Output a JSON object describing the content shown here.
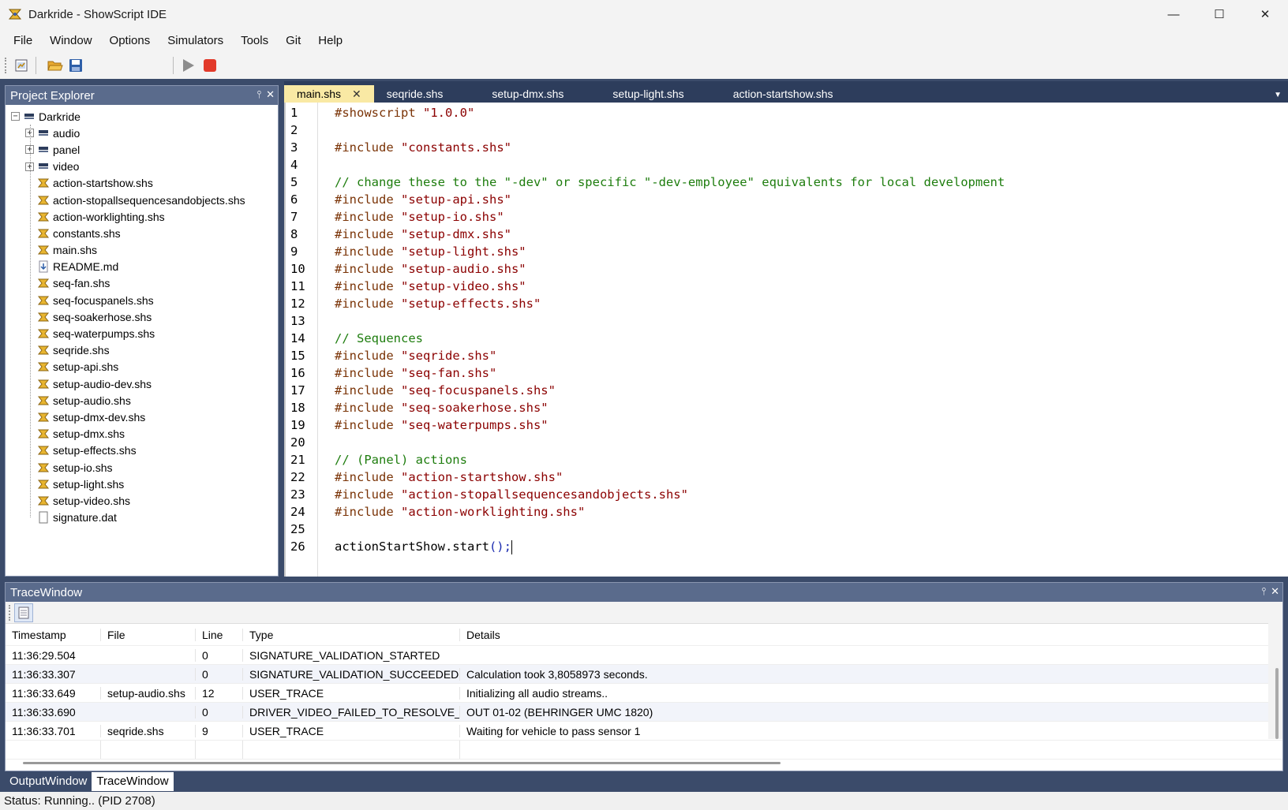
{
  "window": {
    "title": "Darkride - ShowScript IDE",
    "controls": [
      "minimize",
      "maximize",
      "close"
    ]
  },
  "menu": [
    "File",
    "Window",
    "Options",
    "Simulators",
    "Tools",
    "Git",
    "Help"
  ],
  "toolbar": {
    "icons": [
      "new-project-icon",
      "open-folder-icon",
      "save-icon",
      "run-icon",
      "stop-icon"
    ],
    "colors": {
      "run": "#8c8c8c",
      "stop": "#e23a2a",
      "folder": "#e8a930",
      "save": "#2e5fa8"
    }
  },
  "explorer": {
    "title": "Project Explorer",
    "root": "Darkride",
    "folders": [
      "audio",
      "panel",
      "video"
    ],
    "files": [
      "action-startshow.shs",
      "action-stopallsequencesandobjects.shs",
      "action-worklighting.shs",
      "constants.shs",
      "main.shs",
      "README.md",
      "seq-fan.shs",
      "seq-focuspanels.shs",
      "seq-soakerhose.shs",
      "seq-waterpumps.shs",
      "seqride.shs",
      "setup-api.shs",
      "setup-audio-dev.shs",
      "setup-audio.shs",
      "setup-dmx-dev.shs",
      "setup-dmx.shs",
      "setup-effects.shs",
      "setup-io.shs",
      "setup-light.shs",
      "setup-video.shs",
      "signature.dat"
    ]
  },
  "editor": {
    "tabs": [
      "main.shs",
      "seqride.shs",
      "setup-dmx.shs",
      "setup-light.shs",
      "action-startshow.shs"
    ],
    "active_tab": "main.shs",
    "lines": [
      {
        "n": "1",
        "kind": "dir",
        "text": "#showscript \"1.0.0\""
      },
      {
        "n": "2",
        "kind": "plain",
        "text": ""
      },
      {
        "n": "3",
        "kind": "dir",
        "text": "#include \"constants.shs\""
      },
      {
        "n": "4",
        "kind": "plain",
        "text": ""
      },
      {
        "n": "5",
        "kind": "com",
        "text": "// change these to the \"-dev\" or specific \"-dev-employee\" equivalents for local development"
      },
      {
        "n": "6",
        "kind": "dir",
        "text": "#include \"setup-api.shs\""
      },
      {
        "n": "7",
        "kind": "dir",
        "text": "#include \"setup-io.shs\""
      },
      {
        "n": "8",
        "kind": "dir",
        "text": "#include \"setup-dmx.shs\""
      },
      {
        "n": "9",
        "kind": "dir",
        "text": "#include \"setup-light.shs\""
      },
      {
        "n": "10",
        "kind": "dir",
        "text": "#include \"setup-audio.shs\""
      },
      {
        "n": "11",
        "kind": "dir",
        "text": "#include \"setup-video.shs\""
      },
      {
        "n": "12",
        "kind": "dir",
        "text": "#include \"setup-effects.shs\""
      },
      {
        "n": "13",
        "kind": "plain",
        "text": ""
      },
      {
        "n": "14",
        "kind": "com",
        "text": "// Sequences"
      },
      {
        "n": "15",
        "kind": "dir",
        "text": "#include \"seqride.shs\""
      },
      {
        "n": "16",
        "kind": "dir",
        "text": "#include \"seq-fan.shs\""
      },
      {
        "n": "17",
        "kind": "dir",
        "text": "#include \"seq-focuspanels.shs\""
      },
      {
        "n": "18",
        "kind": "dir",
        "text": "#include \"seq-soakerhose.shs\""
      },
      {
        "n": "19",
        "kind": "dir",
        "text": "#include \"seq-waterpumps.shs\""
      },
      {
        "n": "20",
        "kind": "plain",
        "text": ""
      },
      {
        "n": "21",
        "kind": "com",
        "text": "// (Panel) actions"
      },
      {
        "n": "22",
        "kind": "dir",
        "text": "#include \"action-startshow.shs\""
      },
      {
        "n": "23",
        "kind": "dir",
        "text": "#include \"action-stopallsequencesandobjects.shs\""
      },
      {
        "n": "24",
        "kind": "dir",
        "text": "#include \"action-worklighting.shs\""
      },
      {
        "n": "25",
        "kind": "plain",
        "text": ""
      },
      {
        "n": "26",
        "kind": "call",
        "text": "actionStartShow.start();"
      }
    ]
  },
  "trace": {
    "title": "TraceWindow",
    "columns": [
      "Timestamp",
      "File",
      "Line",
      "Type",
      "Details"
    ],
    "rows": [
      [
        "11:36:29.504",
        "",
        "0",
        "SIGNATURE_VALIDATION_STARTED",
        ""
      ],
      [
        "11:36:33.307",
        "",
        "0",
        "SIGNATURE_VALIDATION_SUCCEEDED",
        "Calculation took 3,8058973 seconds."
      ],
      [
        "11:36:33.649",
        "setup-audio.shs",
        "12",
        "USER_TRACE",
        "Initializing all audio streams.."
      ],
      [
        "11:36:33.690",
        "",
        "0",
        "DRIVER_VIDEO_FAILED_TO_RESOLVE_...",
        "OUT 01-02 (BEHRINGER UMC 1820)"
      ],
      [
        "11:36:33.701",
        "seqride.shs",
        "9",
        "USER_TRACE",
        "Waiting for vehicle to pass sensor 1"
      ]
    ]
  },
  "bottom_tabs": [
    "OutputWindow",
    "TraceWindow"
  ],
  "bottom_active": "TraceWindow",
  "status": "Status: Running.. (PID 2708)"
}
